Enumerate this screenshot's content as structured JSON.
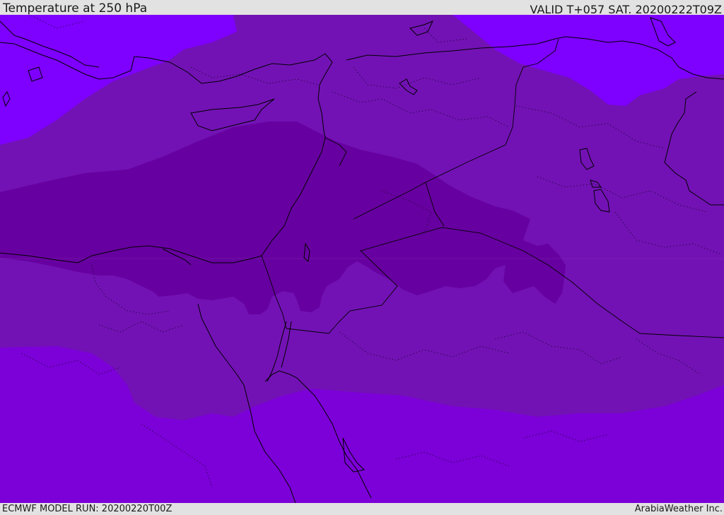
{
  "header": {
    "title": "Temperature at 250 hPa",
    "valid_time": "VALID T+057 SAT. 20200222T09Z"
  },
  "footer": {
    "model_run": "ECMWF MODEL RUN: 20200220T00Z",
    "credit": "ArabiaWeather Inc."
  },
  "map": {
    "colors": {
      "coldest": "#6700a0",
      "cold": "#7212b4",
      "mild": "#7c00d8",
      "bright": "#7e00ff",
      "coastline": "#000000"
    }
  }
}
